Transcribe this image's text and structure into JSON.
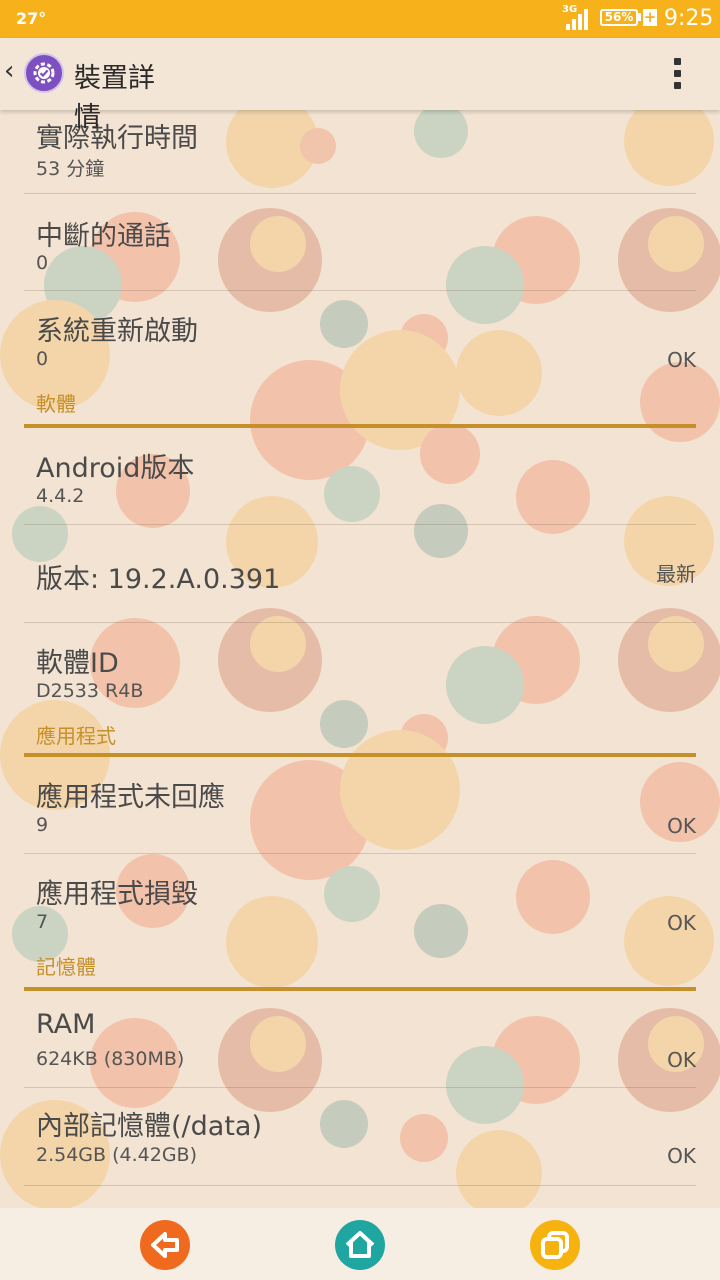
{
  "status_bar": {
    "temperature": "27°",
    "network_type": "3G",
    "battery_percent": "56%",
    "charging_symbol": "+",
    "time": "9:25"
  },
  "action_bar": {
    "title": "裝置詳情"
  },
  "rows": [
    {
      "title": "實際執行時間",
      "value": "53 分鐘",
      "status": ""
    },
    {
      "title": "中斷的通話",
      "value": "0",
      "status": ""
    },
    {
      "title": "系統重新啟動",
      "value": "0",
      "status": "OK"
    }
  ],
  "sections": {
    "software": {
      "header": "軟體",
      "rows": [
        {
          "title": "Android版本",
          "value": "4.4.2",
          "status": ""
        },
        {
          "title": "版本: 19.2.A.0.391",
          "value": "",
          "status": "最新"
        },
        {
          "title": "軟體ID",
          "value": "D2533 R4B",
          "status": ""
        }
      ]
    },
    "apps": {
      "header": "應用程式",
      "rows": [
        {
          "title": "應用程式未回應",
          "value": "9",
          "status": "OK"
        },
        {
          "title": "應用程式損毀",
          "value": "7",
          "status": "OK"
        }
      ]
    },
    "memory": {
      "header": "記憶體",
      "rows": [
        {
          "title": "RAM",
          "value": "624KB (830MB)",
          "status": "OK"
        },
        {
          "title": "內部記憶體(/data)",
          "value": "2.54GB (4.42GB)",
          "status": "OK"
        }
      ]
    }
  },
  "nav_bar": {
    "back_icon": "arrow-left-icon",
    "home_icon": "house-icon",
    "recents_icon": "stacked-squares-icon"
  },
  "colors": {
    "status_bar": "#f7b21b",
    "section_header": "#c5902a",
    "back_button": "#ef6a1f",
    "home_button": "#1fa6a1",
    "recents_button": "#f6b20f"
  }
}
